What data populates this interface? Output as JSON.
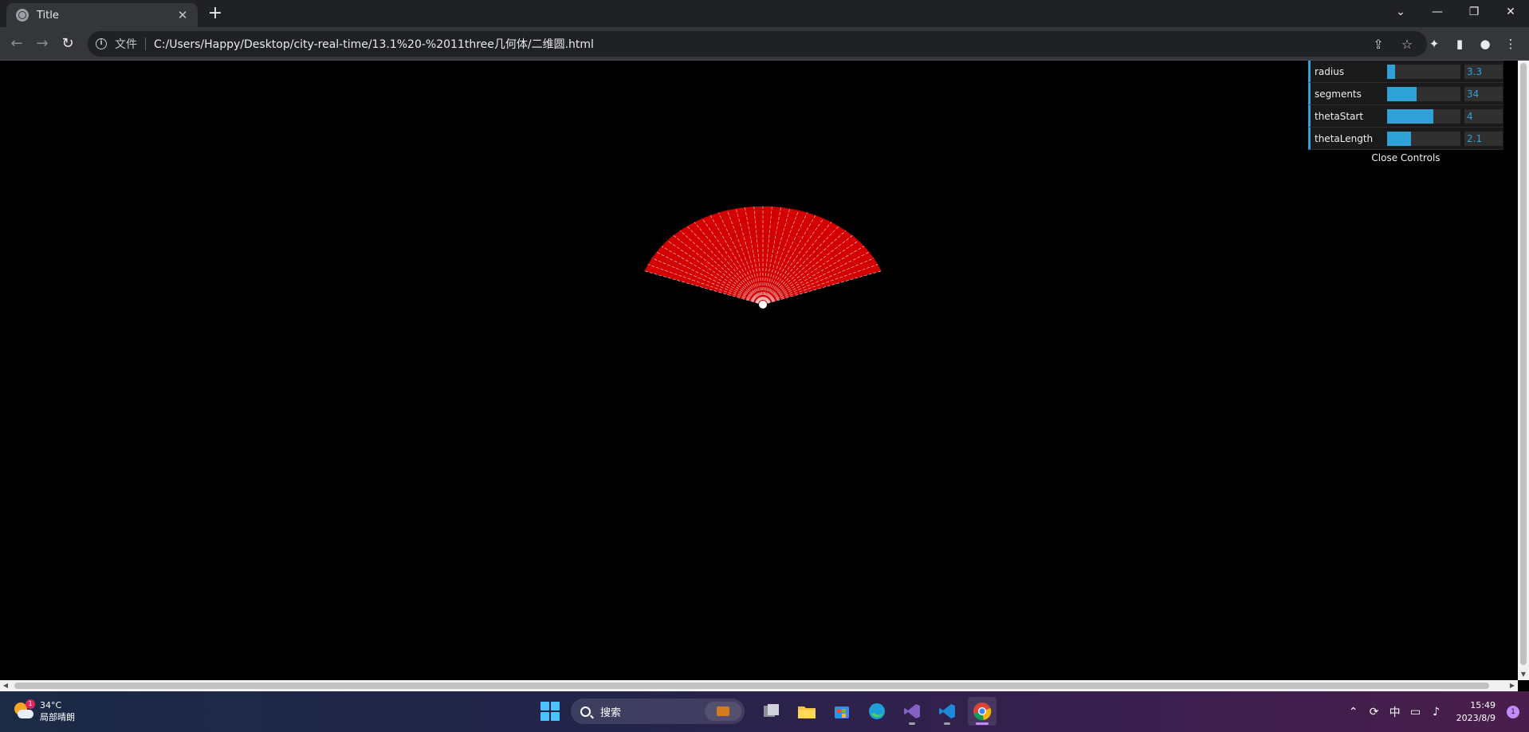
{
  "browser": {
    "tab_title": "Title",
    "tab_close": "✕",
    "new_tab": "+",
    "scheme_label": "文件",
    "url": "C:/Users/Happy/Desktop/city-real-time/13.1%20-%2011three几何体/二维圆.html"
  },
  "gui": {
    "controls": [
      {
        "label": "radius",
        "value": "3.3",
        "fill": 0.11
      },
      {
        "label": "segments",
        "value": "34",
        "fill": 0.4
      },
      {
        "label": "thetaStart",
        "value": "4",
        "fill": 0.63
      },
      {
        "label": "thetaLength",
        "value": "2.1",
        "fill": 0.33
      }
    ],
    "close_label": "Close Controls",
    "accent": "#2fa1d6"
  },
  "scene": {
    "mesh_color": "#d40000",
    "wire_color": "#ffffff",
    "background": "#000000",
    "segments": 34
  },
  "taskbar": {
    "weather_temp": "34°C",
    "weather_desc": "局部晴朗",
    "weather_badge": "1",
    "search_label": "搜索",
    "ime": "中",
    "time": "15:49",
    "date": "2023/8/9",
    "notif_count": "1"
  }
}
